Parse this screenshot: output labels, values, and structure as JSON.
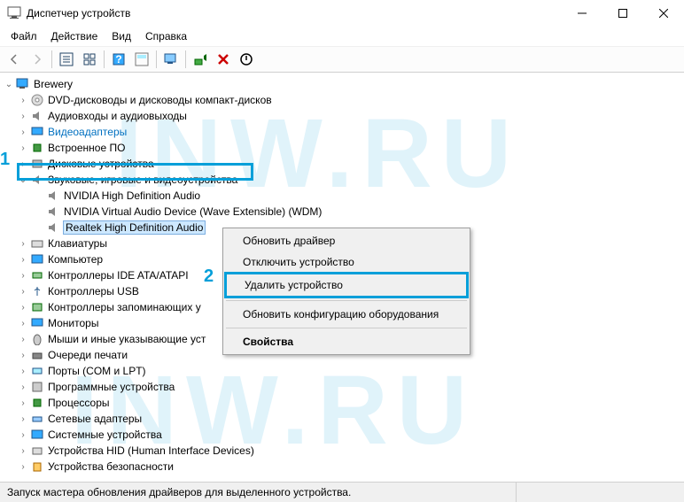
{
  "window": {
    "title": "Диспетчер устройств"
  },
  "menu": {
    "file": "Файл",
    "action": "Действие",
    "view": "Вид",
    "help": "Справка"
  },
  "tree": {
    "root": "Brewery",
    "nodes": {
      "dvd": "DVD-дисководы и дисководы компакт-дисков",
      "audio_io": "Аудиовходы и аудиовыходы",
      "video": "Видеоадаптеры",
      "firmware": "Встроенное ПО",
      "disk": "Дисковые устройства",
      "sound": "Звуковые, игровые и видеоустройства",
      "sound_children": {
        "nvidia_hd": "NVIDIA High Definition Audio",
        "nvidia_virtual": "NVIDIA Virtual Audio Device (Wave Extensible) (WDM)",
        "realtek": "Realtek High Definition Audio"
      },
      "keyboards": "Клавиатуры",
      "computer": "Компьютер",
      "ide": "Контроллеры IDE ATA/ATAPI",
      "usb": "Контроллеры USB",
      "storage": "Контроллеры запоминающих у",
      "monitors": "Мониторы",
      "mice": "Мыши и иные указывающие уст",
      "print_q": "Очереди печати",
      "ports": "Порты (COM и LPT)",
      "software": "Программные устройства",
      "cpu": "Процессоры",
      "network": "Сетевые адаптеры",
      "system": "Системные устройства",
      "hid": "Устройства HID (Human Interface Devices)",
      "security": "Устройства безопасности"
    }
  },
  "context_menu": {
    "update": "Обновить драйвер",
    "disable": "Отключить устройство",
    "uninstall": "Удалить устройство",
    "scan": "Обновить конфигурацию оборудования",
    "properties": "Свойства"
  },
  "annotations": {
    "n1": "1",
    "n2": "2"
  },
  "statusbar": {
    "text": "Запуск мастера обновления драйверов для выделенного устройства."
  },
  "watermark": "INW.RU"
}
